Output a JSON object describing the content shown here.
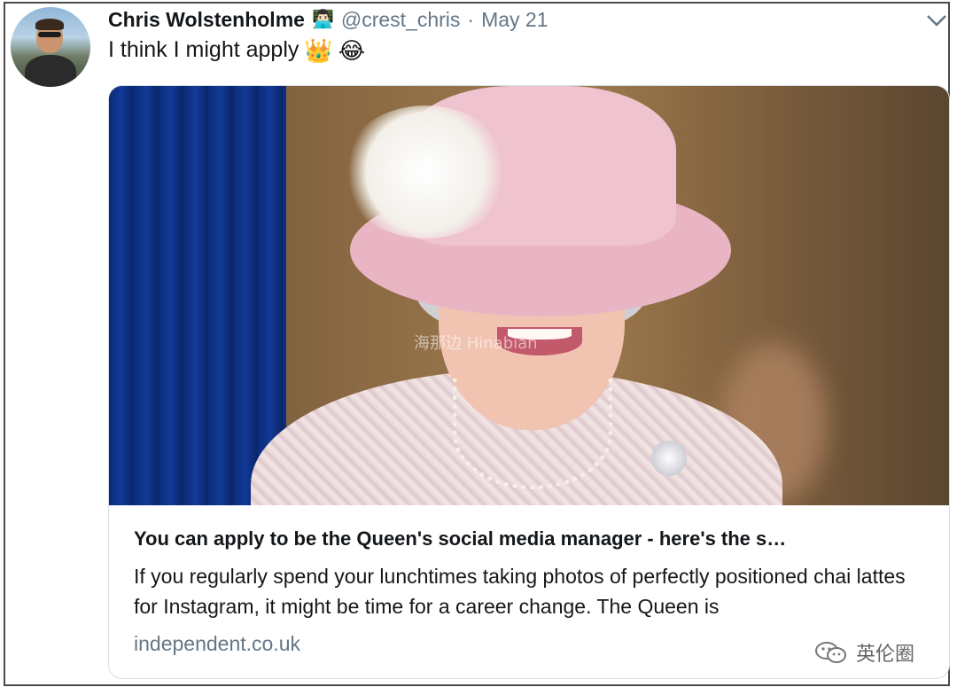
{
  "tweet": {
    "name": "Chris Wolstenholme",
    "name_emoji": "👨🏻‍💻",
    "handle": "@crest_chris",
    "separator": "·",
    "date": "May 21",
    "text": "I think I might apply",
    "emojis": [
      "👑",
      "😂"
    ]
  },
  "card": {
    "watermark": "海那边 Hinabian",
    "title": "You can apply to be the Queen's social media manager - here's the s…",
    "description": "If you regularly spend your lunchtimes taking photos of perfectly positioned chai lattes for Instagram, it might be time for a career change. The Queen is",
    "domain": "independent.co.uk"
  },
  "overlay": {
    "wechat_label": "英伦圈"
  },
  "icons": {
    "menu": "chevron-down-icon",
    "wechat": "wechat-icon"
  },
  "colors": {
    "secondary_text": "#657786",
    "border": "#d8dee3"
  }
}
